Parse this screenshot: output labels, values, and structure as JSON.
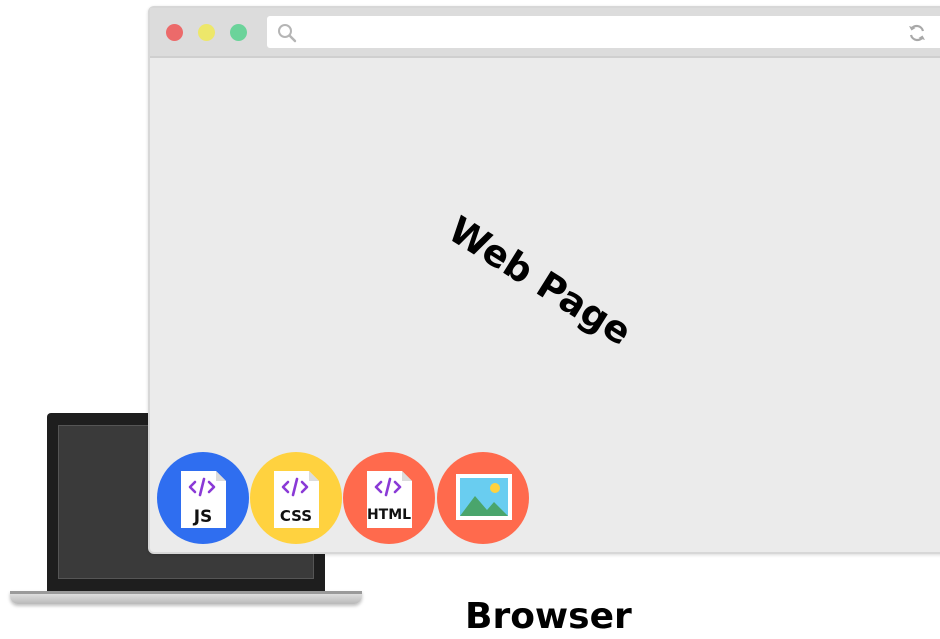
{
  "colors": {
    "close": "#ec6a6a",
    "minimize": "#ede76a",
    "maximize": "#6bd39a",
    "js": "#2f6ef0",
    "css": "#ffd23f",
    "html": "#ff6a4d",
    "image": "#ff6a4d",
    "code_glyph": "#8a3ad6"
  },
  "browser": {
    "icons": [
      "search-icon",
      "reload-icon"
    ],
    "content_label": "Web Page"
  },
  "resources": [
    {
      "type": "js",
      "label": "JS",
      "icon": "js-file-icon"
    },
    {
      "type": "css",
      "label": "CSS",
      "icon": "css-file-icon"
    },
    {
      "type": "html",
      "label": "HTML",
      "icon": "html-file-icon"
    },
    {
      "type": "image",
      "icon": "image-file-icon"
    }
  ],
  "caption": "Browser"
}
